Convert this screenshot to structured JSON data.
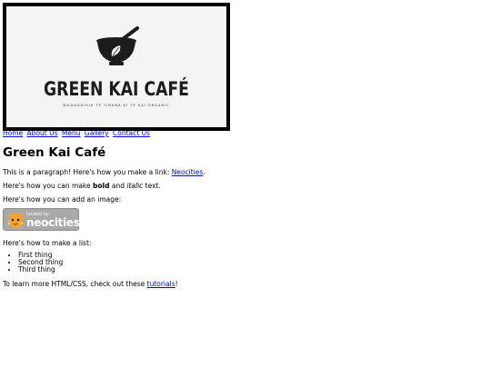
{
  "logo": {
    "brand": "GREEN KAI CAFÉ",
    "tagline": "WHANGAIHIA TE TINANA KI TE KAI ORGANIC"
  },
  "nav": {
    "items": [
      "Home",
      "About Us",
      "Menu",
      "Gallery",
      "Contact Us"
    ]
  },
  "content": {
    "heading": "Green Kai Café",
    "para1_prefix": "This is a paragraph! Here's how you make a link: ",
    "para1_link": "Neocities",
    "para1_suffix": ".",
    "para2_prefix": "Here's how you can make ",
    "para2_bold": "bold",
    "para2_mid": " and ",
    "para2_italic": "italic",
    "para2_suffix": " text.",
    "para3": "Here's how you can add an image:",
    "badge_hosted": "hosted by",
    "badge_name": "neocities",
    "para4": "Here's how to make a list:",
    "list": [
      "First thing",
      "Second thing",
      "Third thing"
    ],
    "para5_prefix": "To learn more HTML/CSS, check out these ",
    "para5_link": "tutorials",
    "para5_suffix": "!"
  },
  "colors": {
    "link": "#0000ee",
    "badge": "#a9a9a9",
    "logo_bg": "#f4f4f4"
  }
}
